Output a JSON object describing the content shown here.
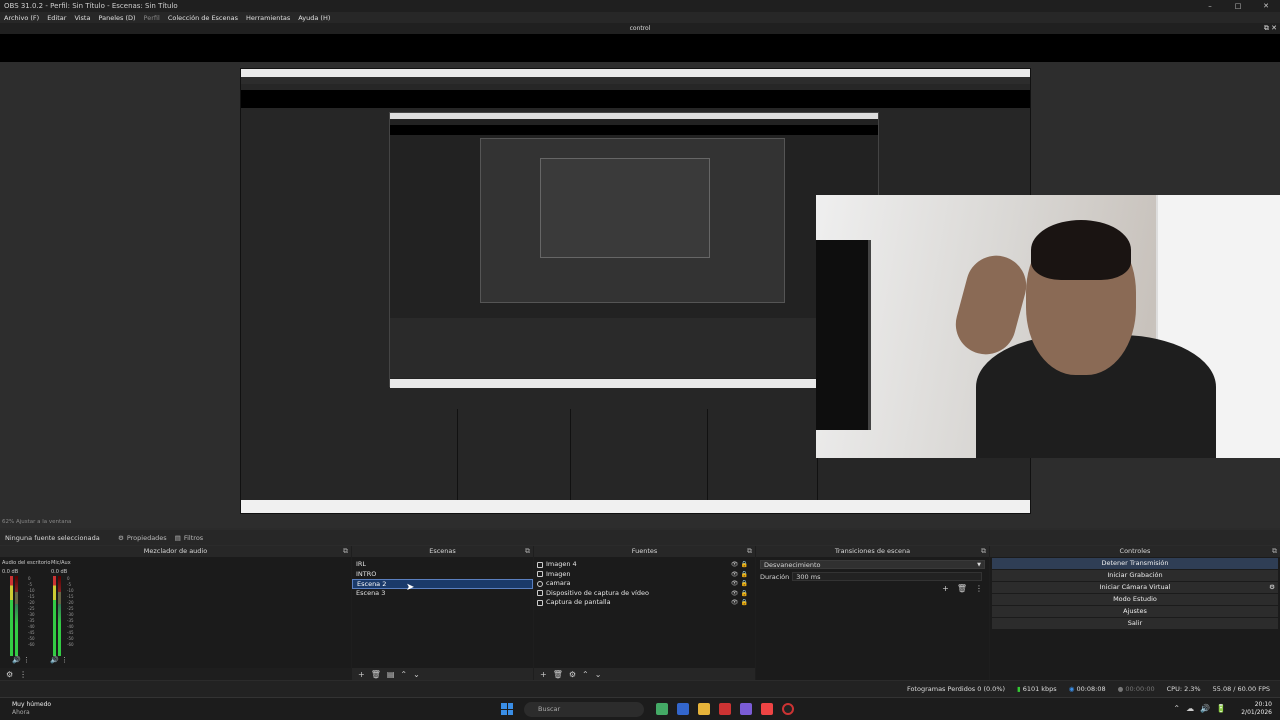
{
  "window": {
    "title": "OBS 31.0.2 - Perfil: Sin Título - Escenas: Sin Título",
    "controls": [
      "–",
      "□",
      "✕"
    ]
  },
  "menu": [
    "Archivo (F)",
    "Editar",
    "Vista",
    "Paneles (D)",
    "Perfil",
    "Colección de Escenas",
    "Herramientas",
    "Ayuda (H)"
  ],
  "projector": {
    "title": "control"
  },
  "preview": {
    "zoom_label": "62% Ajustar a la ventana"
  },
  "context": {
    "no_source": "Ninguna fuente seleccionada",
    "properties": "Propiedades",
    "filters": "Filtros"
  },
  "mixer": {
    "title": "Mezclador de audio",
    "channels": [
      {
        "name": "Audio del escritorio",
        "db": "0.0 dB"
      },
      {
        "name": "Mic/Aux",
        "db": "0.0 dB"
      }
    ]
  },
  "scenes": {
    "title": "Escenas",
    "items": [
      "IRL",
      "INTRO",
      "Escena 2",
      "Escena 3"
    ],
    "selected": "Escena 2"
  },
  "sources": {
    "title": "Fuentes",
    "items": [
      "Imagen 4",
      "Imagen",
      "camara",
      "Dispositivo de captura de vídeo",
      "Captura de pantalla"
    ]
  },
  "transitions": {
    "title": "Transiciones de escena",
    "type": "Desvanecimiento",
    "duration_label": "Duración",
    "duration": "300 ms"
  },
  "controls": {
    "title": "Controles",
    "buttons": [
      "Detener Transmisión",
      "Iniciar Grabación",
      "Iniciar Cámara Virtual",
      "Modo Estudio",
      "Ajustes",
      "Salir"
    ]
  },
  "status": {
    "dropped": "Fotogramas Perdidos 0 (0.0%)",
    "bitrate": "6101 kbps",
    "stream_time": "00:08:08",
    "rec_time": "00:00:00",
    "cpu": "CPU: 2.3%",
    "fps": "55.08 / 60.00 FPS"
  },
  "taskbar": {
    "weather": "Muy húmedo",
    "weather_sub": "Ahora",
    "search": "Buscar",
    "time": "20:10",
    "date": "2/01/2026"
  },
  "colors": {
    "accent": "#2f3e55",
    "selection": "#1a3a6a",
    "live": "#33cc33"
  }
}
